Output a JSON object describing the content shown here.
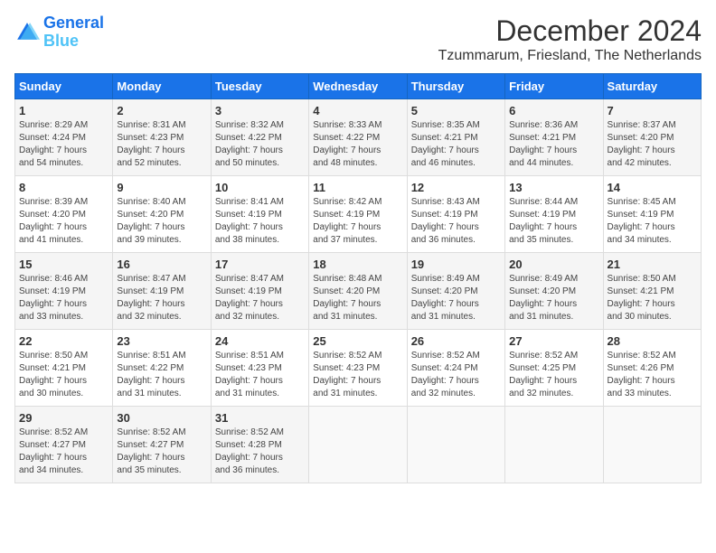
{
  "logo": {
    "line1": "General",
    "line2": "Blue"
  },
  "title": "December 2024",
  "location": "Tzummarum, Friesland, The Netherlands",
  "days_of_week": [
    "Sunday",
    "Monday",
    "Tuesday",
    "Wednesday",
    "Thursday",
    "Friday",
    "Saturday"
  ],
  "weeks": [
    [
      {
        "day": "1",
        "sunrise": "8:29 AM",
        "sunset": "4:24 PM",
        "daylight": "7 hours and 54 minutes."
      },
      {
        "day": "2",
        "sunrise": "8:31 AM",
        "sunset": "4:23 PM",
        "daylight": "7 hours and 52 minutes."
      },
      {
        "day": "3",
        "sunrise": "8:32 AM",
        "sunset": "4:22 PM",
        "daylight": "7 hours and 50 minutes."
      },
      {
        "day": "4",
        "sunrise": "8:33 AM",
        "sunset": "4:22 PM",
        "daylight": "7 hours and 48 minutes."
      },
      {
        "day": "5",
        "sunrise": "8:35 AM",
        "sunset": "4:21 PM",
        "daylight": "7 hours and 46 minutes."
      },
      {
        "day": "6",
        "sunrise": "8:36 AM",
        "sunset": "4:21 PM",
        "daylight": "7 hours and 44 minutes."
      },
      {
        "day": "7",
        "sunrise": "8:37 AM",
        "sunset": "4:20 PM",
        "daylight": "7 hours and 42 minutes."
      }
    ],
    [
      {
        "day": "8",
        "sunrise": "8:39 AM",
        "sunset": "4:20 PM",
        "daylight": "7 hours and 41 minutes."
      },
      {
        "day": "9",
        "sunrise": "8:40 AM",
        "sunset": "4:20 PM",
        "daylight": "7 hours and 39 minutes."
      },
      {
        "day": "10",
        "sunrise": "8:41 AM",
        "sunset": "4:19 PM",
        "daylight": "7 hours and 38 minutes."
      },
      {
        "day": "11",
        "sunrise": "8:42 AM",
        "sunset": "4:19 PM",
        "daylight": "7 hours and 37 minutes."
      },
      {
        "day": "12",
        "sunrise": "8:43 AM",
        "sunset": "4:19 PM",
        "daylight": "7 hours and 36 minutes."
      },
      {
        "day": "13",
        "sunrise": "8:44 AM",
        "sunset": "4:19 PM",
        "daylight": "7 hours and 35 minutes."
      },
      {
        "day": "14",
        "sunrise": "8:45 AM",
        "sunset": "4:19 PM",
        "daylight": "7 hours and 34 minutes."
      }
    ],
    [
      {
        "day": "15",
        "sunrise": "8:46 AM",
        "sunset": "4:19 PM",
        "daylight": "7 hours and 33 minutes."
      },
      {
        "day": "16",
        "sunrise": "8:47 AM",
        "sunset": "4:19 PM",
        "daylight": "7 hours and 32 minutes."
      },
      {
        "day": "17",
        "sunrise": "8:47 AM",
        "sunset": "4:19 PM",
        "daylight": "7 hours and 32 minutes."
      },
      {
        "day": "18",
        "sunrise": "8:48 AM",
        "sunset": "4:20 PM",
        "daylight": "7 hours and 31 minutes."
      },
      {
        "day": "19",
        "sunrise": "8:49 AM",
        "sunset": "4:20 PM",
        "daylight": "7 hours and 31 minutes."
      },
      {
        "day": "20",
        "sunrise": "8:49 AM",
        "sunset": "4:20 PM",
        "daylight": "7 hours and 31 minutes."
      },
      {
        "day": "21",
        "sunrise": "8:50 AM",
        "sunset": "4:21 PM",
        "daylight": "7 hours and 30 minutes."
      }
    ],
    [
      {
        "day": "22",
        "sunrise": "8:50 AM",
        "sunset": "4:21 PM",
        "daylight": "7 hours and 30 minutes."
      },
      {
        "day": "23",
        "sunrise": "8:51 AM",
        "sunset": "4:22 PM",
        "daylight": "7 hours and 31 minutes."
      },
      {
        "day": "24",
        "sunrise": "8:51 AM",
        "sunset": "4:23 PM",
        "daylight": "7 hours and 31 minutes."
      },
      {
        "day": "25",
        "sunrise": "8:52 AM",
        "sunset": "4:23 PM",
        "daylight": "7 hours and 31 minutes."
      },
      {
        "day": "26",
        "sunrise": "8:52 AM",
        "sunset": "4:24 PM",
        "daylight": "7 hours and 32 minutes."
      },
      {
        "day": "27",
        "sunrise": "8:52 AM",
        "sunset": "4:25 PM",
        "daylight": "7 hours and 32 minutes."
      },
      {
        "day": "28",
        "sunrise": "8:52 AM",
        "sunset": "4:26 PM",
        "daylight": "7 hours and 33 minutes."
      }
    ],
    [
      {
        "day": "29",
        "sunrise": "8:52 AM",
        "sunset": "4:27 PM",
        "daylight": "7 hours and 34 minutes."
      },
      {
        "day": "30",
        "sunrise": "8:52 AM",
        "sunset": "4:27 PM",
        "daylight": "7 hours and 35 minutes."
      },
      {
        "day": "31",
        "sunrise": "8:52 AM",
        "sunset": "4:28 PM",
        "daylight": "7 hours and 36 minutes."
      },
      null,
      null,
      null,
      null
    ]
  ],
  "labels": {
    "sunrise": "Sunrise:",
    "sunset": "Sunset:",
    "daylight": "Daylight:"
  }
}
